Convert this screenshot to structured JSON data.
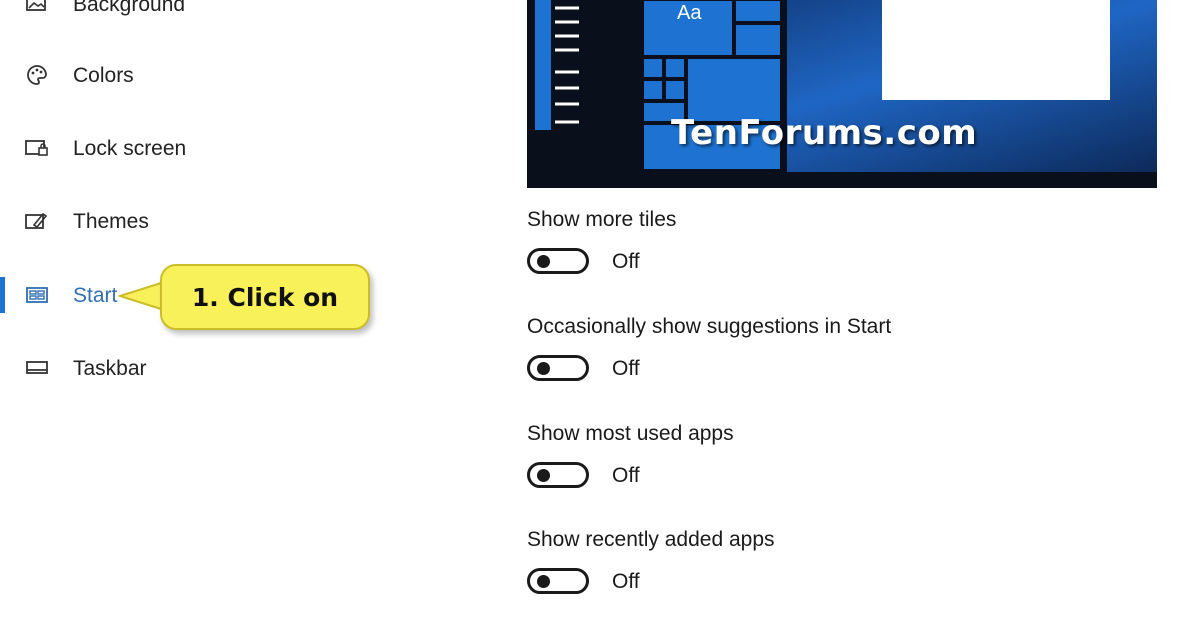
{
  "sidebar": {
    "items": [
      {
        "label": "Background",
        "icon": "background-image-icon",
        "selected": false
      },
      {
        "label": "Colors",
        "icon": "palette-icon",
        "selected": false
      },
      {
        "label": "Lock screen",
        "icon": "lock-screen-icon",
        "selected": false
      },
      {
        "label": "Themes",
        "icon": "themes-icon",
        "selected": false
      },
      {
        "label": "Start",
        "icon": "start-tiles-icon",
        "selected": true
      },
      {
        "label": "Taskbar",
        "icon": "taskbar-icon",
        "selected": false
      }
    ]
  },
  "callout": {
    "text": "1. Click on"
  },
  "preview": {
    "brand": "TenForums.com",
    "tile_label": "Aa"
  },
  "settings": [
    {
      "title": "Show more tiles",
      "state": "Off"
    },
    {
      "title": "Occasionally show suggestions in Start",
      "state": "Off"
    },
    {
      "title": "Show most used apps",
      "state": "Off"
    },
    {
      "title": "Show recently added apps",
      "state": "Off"
    }
  ],
  "colors": {
    "accent": "#1e73d2",
    "selected_text": "#2f6fb5",
    "callout": "#f9f15a",
    "tile_blue": "#1e73d2"
  }
}
